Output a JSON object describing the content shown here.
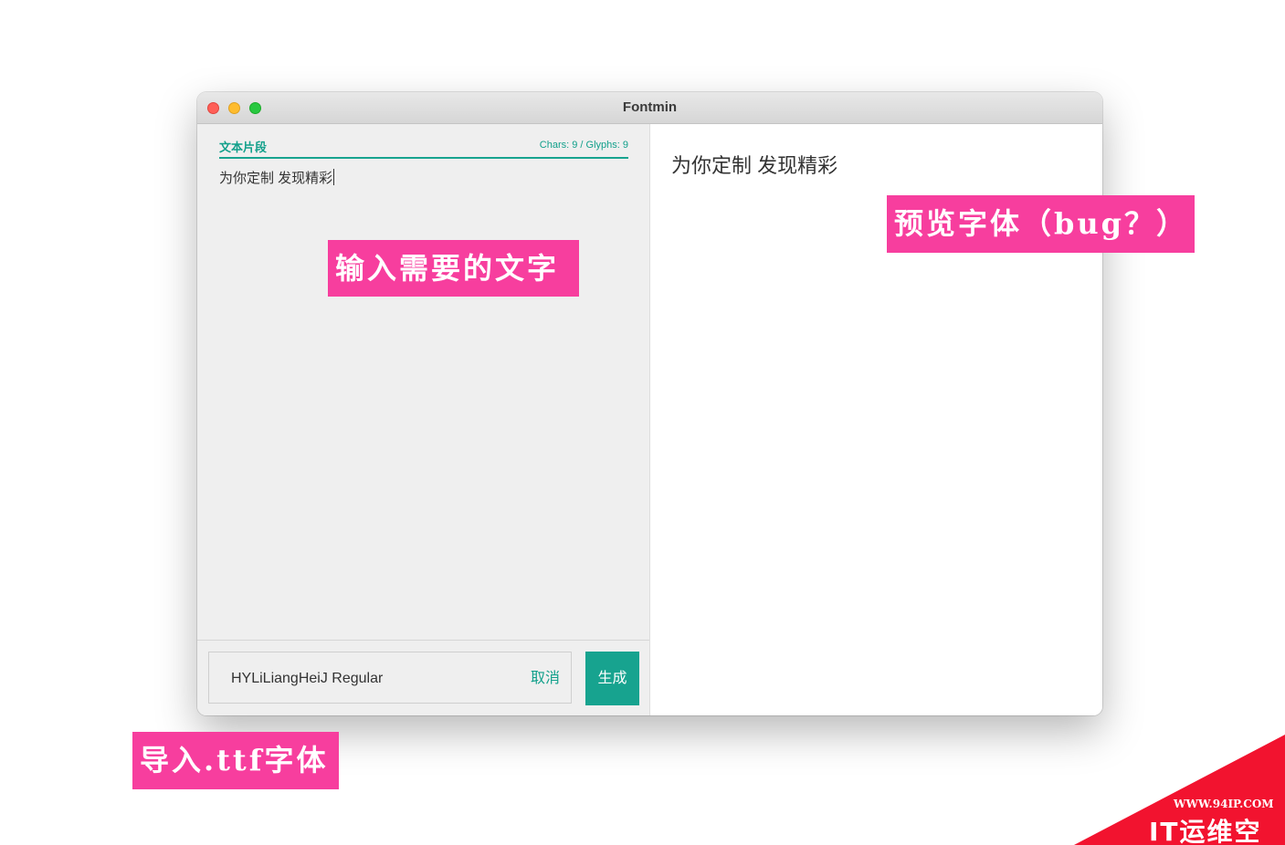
{
  "window": {
    "title": "Fontmin"
  },
  "left_pane": {
    "section_title": "文本片段",
    "counter": "Chars: 9 / Glyphs: 9",
    "input_text": "为你定制 发现精彩",
    "font_name": "HYLiLiangHeiJ Regular",
    "cancel_label": "取消",
    "generate_label": "生成"
  },
  "right_pane": {
    "preview_text": "为你定制 发现精彩"
  },
  "annotations": {
    "input_hint": "输入需要的文字",
    "preview_hint": "预览字体（bug？）",
    "import_hint": "导入.ttf字体"
  },
  "watermark": {
    "url": "WWW.94IP.COM",
    "brand": "IT运维空间"
  },
  "colors": {
    "accent": "#17a38f",
    "annotation": "#f73e9e",
    "watermark": "#f2132f",
    "traffic_close": "#ff5f57",
    "traffic_min": "#febc2e",
    "traffic_max": "#28c840"
  }
}
